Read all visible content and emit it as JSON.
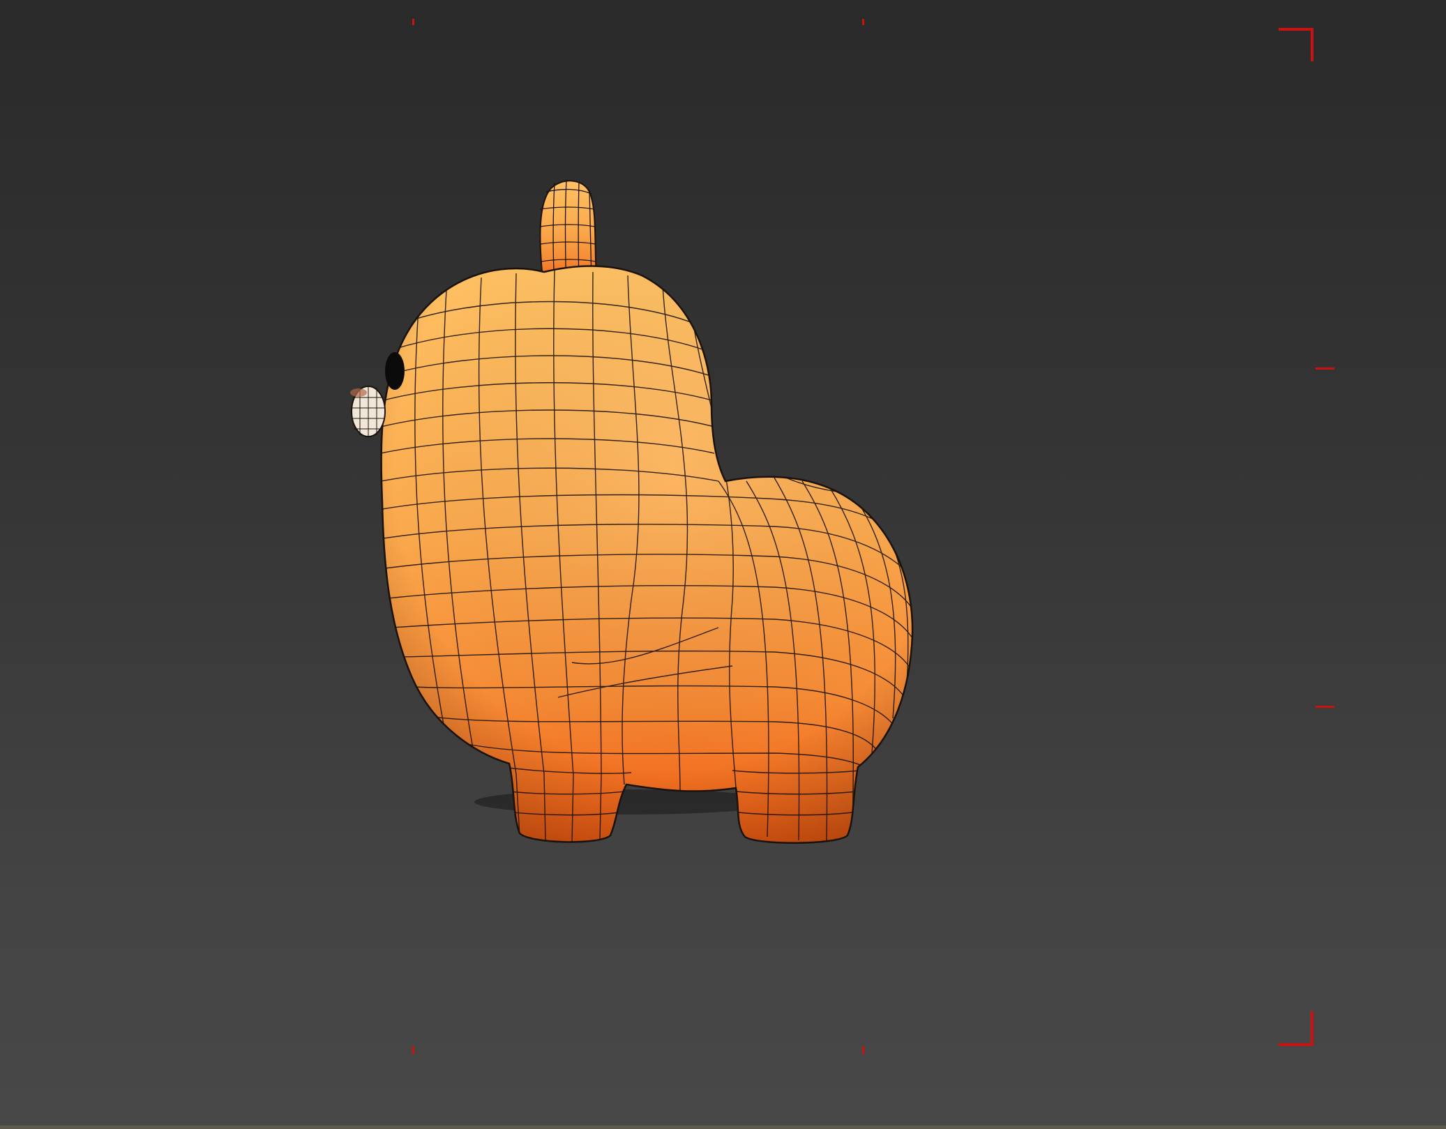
{
  "viewport": {
    "background_top": "#2a2a2a",
    "background_bottom": "#484848",
    "safe_frame_color": "#cc1111"
  },
  "model": {
    "base_color_light": "#ffbb5c",
    "base_color_dark": "#f05a10",
    "wire_color": "#1a1208",
    "eye_color": "#0b0b0b",
    "nose_color": "#f2e6d8"
  }
}
